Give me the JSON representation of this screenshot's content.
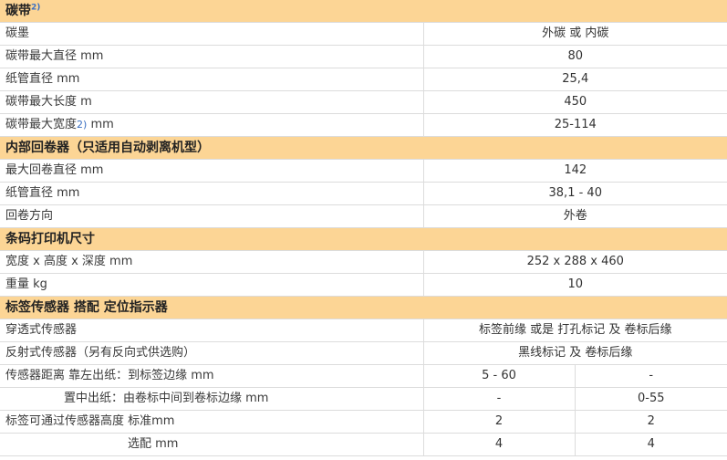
{
  "sections": {
    "ribbon": {
      "title": "碳带",
      "title_sup": "2)",
      "rows": [
        {
          "label": "碳墨",
          "value": "外碳 或 内碳"
        },
        {
          "label": "碳带最大直径 mm",
          "value": "80"
        },
        {
          "label": "纸管直径 mm",
          "value": "25,4"
        },
        {
          "label": "碳带最大长度 m",
          "value": "450"
        },
        {
          "label_pre": "碳带最大宽度",
          "label_sup": "2)",
          "label_post": " mm",
          "value": "25-114"
        }
      ]
    },
    "rewinder": {
      "title": "内部回卷器（只适用自动剥离机型）",
      "rows": [
        {
          "label": "最大回卷直径 mm",
          "value": "142"
        },
        {
          "label": "纸管直径 mm",
          "value": "38,1 - 40"
        },
        {
          "label": "回卷方向",
          "value": "外卷"
        }
      ]
    },
    "printer": {
      "title": "条码打印机尺寸",
      "rows": [
        {
          "label": "宽度 x 高度 x 深度 mm",
          "value": "252 x 288 x 460"
        },
        {
          "label": "重量 kg",
          "value": "10"
        }
      ]
    },
    "sensor": {
      "title": "标签传感器 搭配 定位指示器",
      "rows_full": [
        {
          "label": "穿透式传感器",
          "value": "标签前缘 或是 打孔标记 及 卷标后缘"
        },
        {
          "label": "反射式传感器（另有反向式供选购）",
          "value": "黑线标记 及 卷标后缘"
        }
      ],
      "rows_split": [
        {
          "label": "传感器距离 靠左出纸：到标签边缘 mm",
          "value1": "5 - 60",
          "value2": "-"
        },
        {
          "label": "置中出纸：由卷标中间到卷标边缘 mm",
          "value1": "-",
          "value2": "0-55"
        },
        {
          "label": "标签可通过传感器高度 标准mm",
          "value1": "2",
          "value2": "2"
        },
        {
          "label": "选配 mm",
          "value1": "4",
          "value2": "4"
        }
      ]
    }
  }
}
